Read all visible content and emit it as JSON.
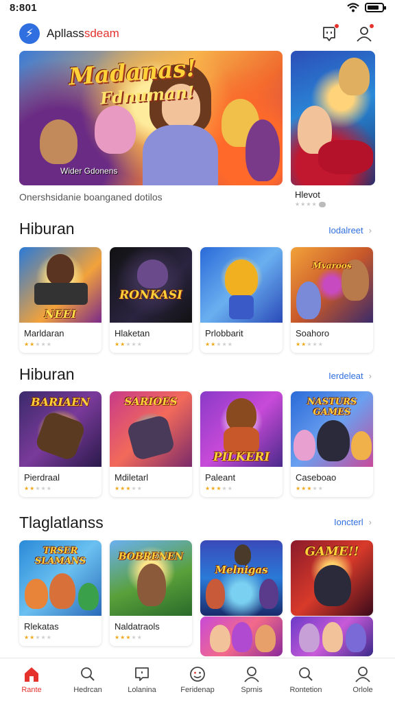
{
  "status_bar": {
    "time": "8:801"
  },
  "header": {
    "app_name_prefix": "Apllass",
    "app_name_accent": "sdeam",
    "logo_glyph": "⚡",
    "icons": [
      "notification-icon",
      "profile-icon"
    ]
  },
  "banner": {
    "title": "Madanas!",
    "subtitle": "Fdnuman!",
    "caption": "Wider Gdonens",
    "description": "Onershsidanie boanganed dotilos",
    "side_title": "Hlevot",
    "side_stars": "★★★★"
  },
  "sections": [
    {
      "title": "Hiburan",
      "see_all": "Iodalreet",
      "items": [
        {
          "name": "Marldaran",
          "rating": 2,
          "thumb_text": "NEEI"
        },
        {
          "name": "Hlaketan",
          "rating": 2,
          "thumb_text": "RONKASI"
        },
        {
          "name": "Prlobbarit",
          "rating": 2,
          "thumb_text": ""
        },
        {
          "name": "Soahoro",
          "rating": 2,
          "thumb_text": "Mvaroos"
        }
      ]
    },
    {
      "title": "Hiburan",
      "see_all": "Ierdeleat",
      "items": [
        {
          "name": "Pierdraal",
          "rating": 2,
          "thumb_text": "BARIAEN"
        },
        {
          "name": "Mdiletarl",
          "rating": 3,
          "thumb_text": "SARIOES"
        },
        {
          "name": "Paleant",
          "rating": 3,
          "thumb_text": "PILKERI"
        },
        {
          "name": "Caseboao",
          "rating": 3,
          "thumb_text": "NASTURS GAMES"
        }
      ]
    },
    {
      "title": "Tlaglatlanss",
      "see_all": "Ioncterl",
      "items": [
        {
          "name": "Rlekatas",
          "rating": 2,
          "thumb_text": "TRSER SLAMANS"
        },
        {
          "name": "Naldatraols",
          "rating": 3,
          "thumb_text": "BOBRENEN"
        },
        {
          "name": "",
          "rating": 0,
          "thumb_text": "Melnigas"
        },
        {
          "name": "",
          "rating": 0,
          "thumb_text": "GAME!!"
        }
      ]
    }
  ],
  "bottom_nav": [
    {
      "label": "Rante",
      "icon": "home-icon",
      "active": true
    },
    {
      "label": "Hedrcan",
      "icon": "search-icon",
      "active": false
    },
    {
      "label": "Lolanina",
      "icon": "chat-icon",
      "active": false
    },
    {
      "label": "Feridenap",
      "icon": "smiley-icon",
      "active": false
    },
    {
      "label": "Sprnis",
      "icon": "user-icon",
      "active": false
    },
    {
      "label": "Rontetion",
      "icon": "search-icon",
      "active": false
    },
    {
      "label": "Orlole",
      "icon": "user-icon",
      "active": false
    }
  ],
  "colors": {
    "accent": "#e5322d",
    "link": "#2f6fe0",
    "star": "#f0a81c"
  }
}
